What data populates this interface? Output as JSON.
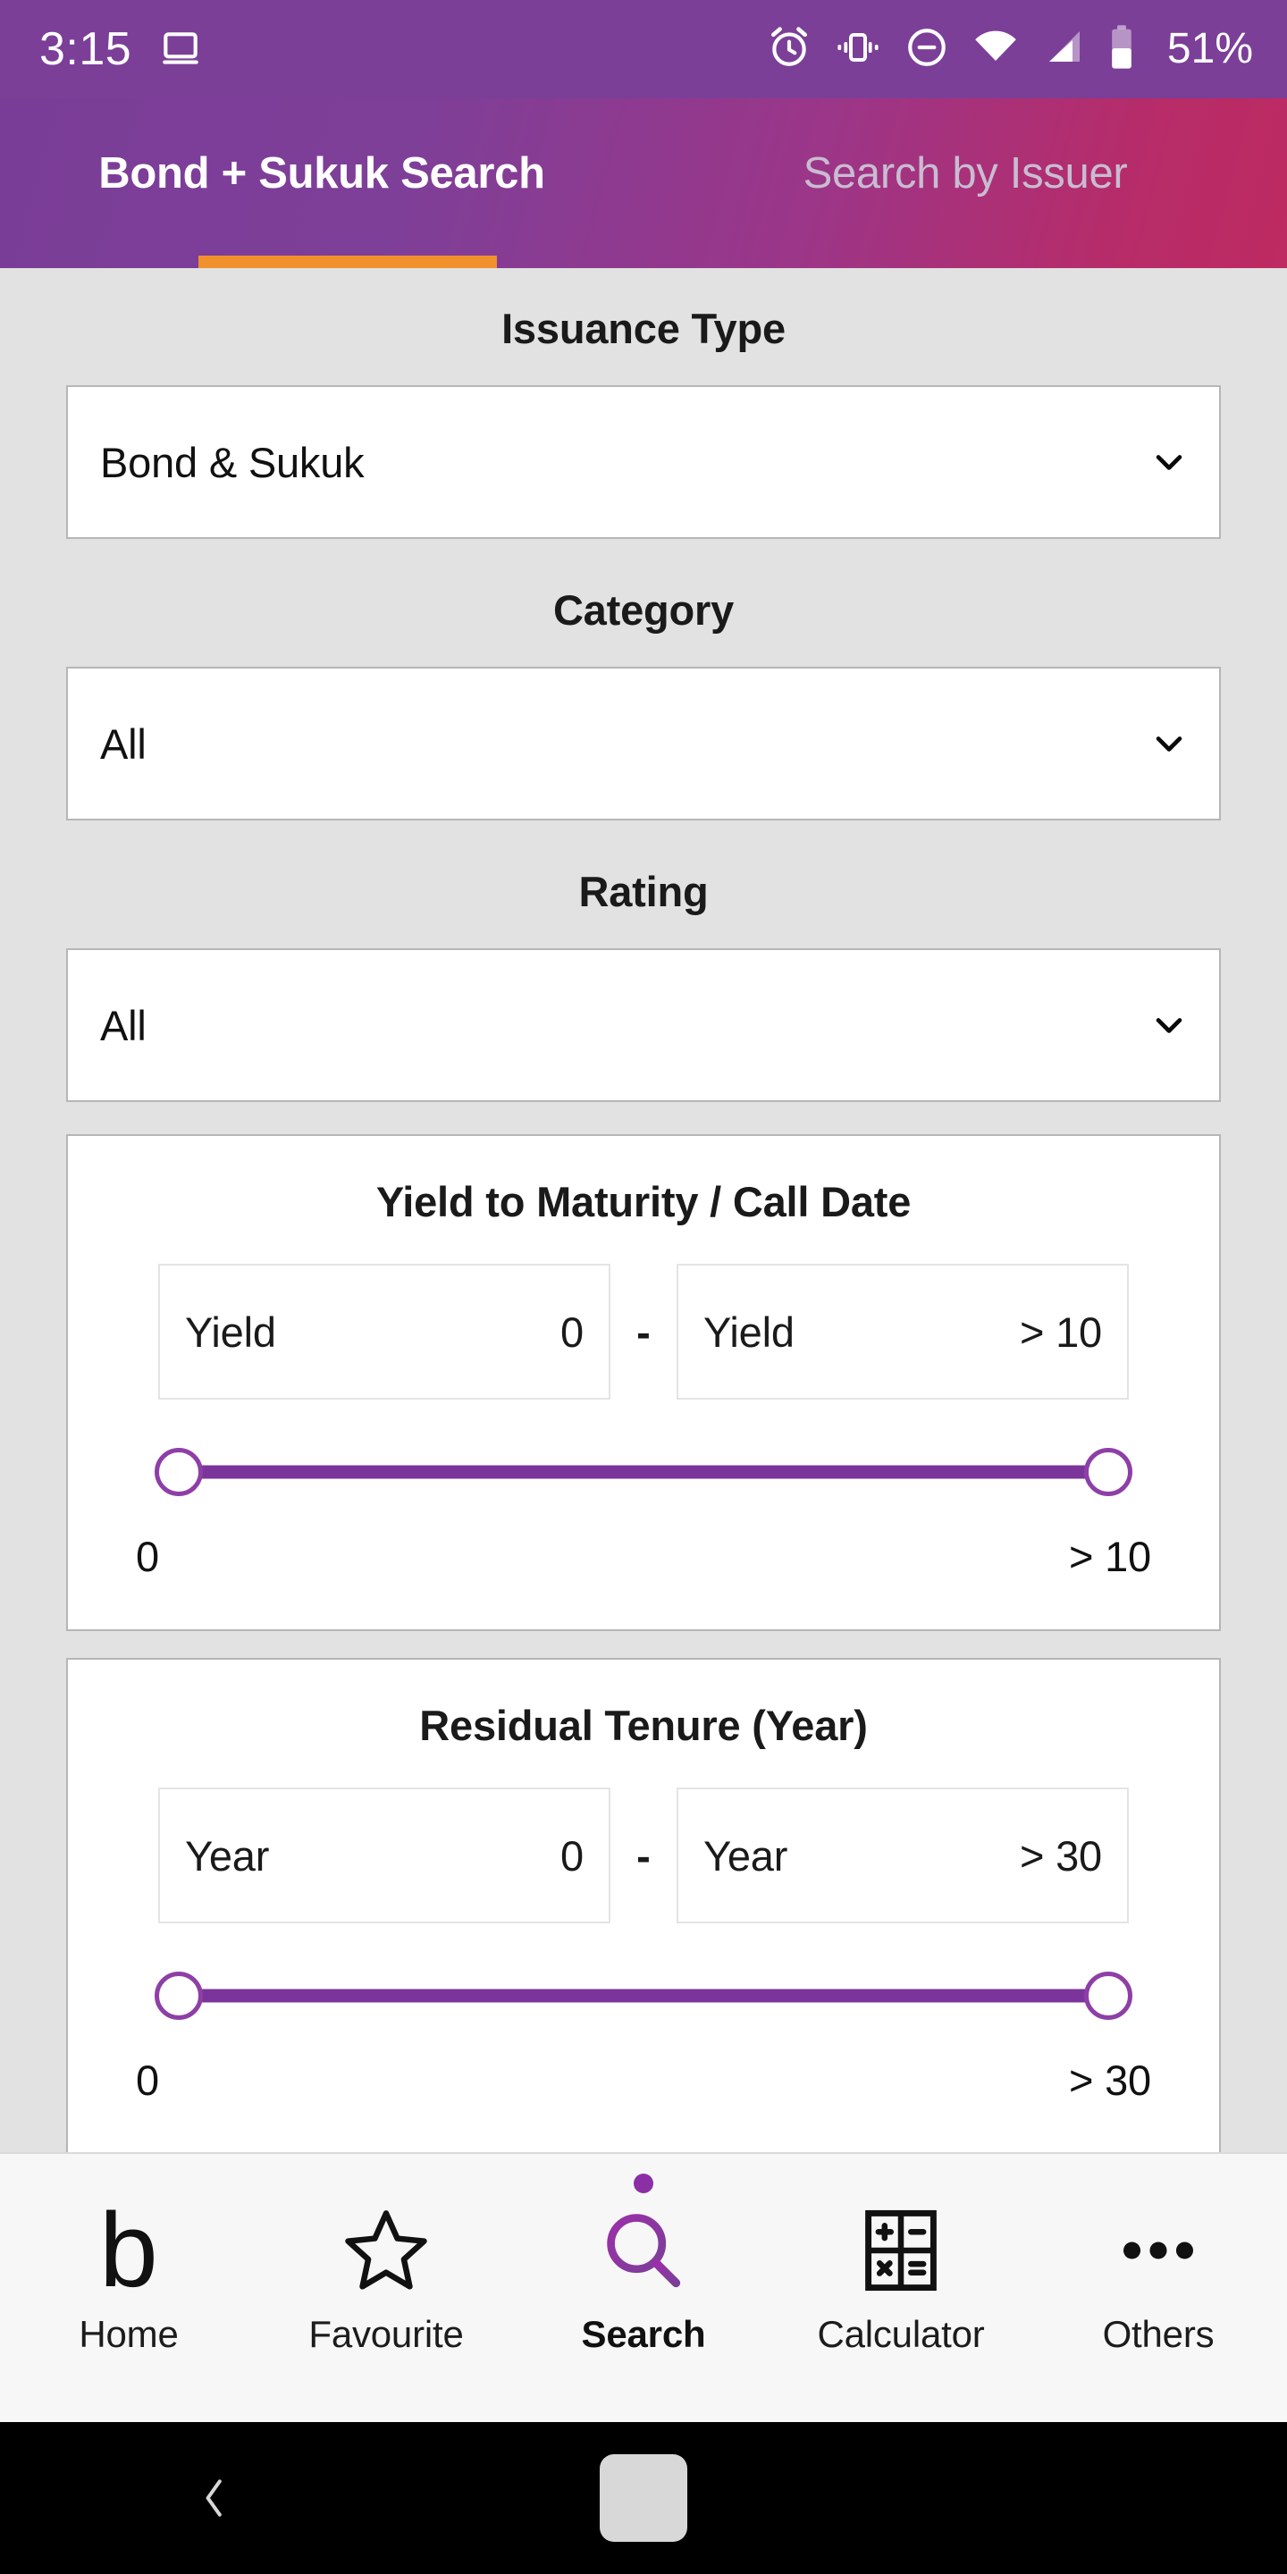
{
  "statusbar": {
    "time": "3:15",
    "battery_percent": "51%",
    "icons": [
      "cast-icon",
      "alarm-icon",
      "vibrate-icon",
      "do-not-disturb-icon",
      "wifi-icon",
      "cellular-signal-icon",
      "battery-icon"
    ],
    "background_color": "#7B3F98"
  },
  "header": {
    "gradient_from": "#7A3D97",
    "gradient_to": "#BE2A61",
    "indicator_color": "#F0912D",
    "tabs": [
      {
        "label": "Bond + Sukuk Search",
        "active": true
      },
      {
        "label": "Search by Issuer",
        "active": false
      }
    ]
  },
  "form": {
    "issuance_type": {
      "label": "Issuance Type",
      "value": "Bond & Sukuk"
    },
    "category": {
      "label": "Category",
      "value": "All"
    },
    "rating": {
      "label": "Rating",
      "value": "All"
    },
    "yield_range": {
      "title": "Yield to Maturity / Call Date",
      "min_placeholder": "Yield",
      "min_value": "0",
      "separator": "-",
      "max_placeholder": "Yield",
      "max_value": "> 10",
      "scale_min": "0",
      "scale_max": "> 10",
      "slider_color": "#7B349A"
    },
    "tenure_range": {
      "title": "Residual Tenure (Year)",
      "min_placeholder": "Year",
      "min_value": "0",
      "separator": "-",
      "max_placeholder": "Year",
      "max_value": "> 30",
      "scale_min": "0",
      "scale_max": "> 30",
      "slider_color": "#7B349A"
    }
  },
  "bottom_nav": {
    "active_color": "#8B2FA6",
    "items": [
      {
        "label": "Home",
        "icon": "b-logo-icon",
        "active": false
      },
      {
        "label": "Favourite",
        "icon": "star-outline-icon",
        "active": false
      },
      {
        "label": "Search",
        "icon": "magnifier-icon",
        "active": true
      },
      {
        "label": "Calculator",
        "icon": "calculator-icon",
        "active": false
      },
      {
        "label": "Others",
        "icon": "ellipsis-icon",
        "active": false
      }
    ]
  },
  "android_nav": {
    "back": "back-chevron-icon",
    "home": "home-pill-icon"
  }
}
